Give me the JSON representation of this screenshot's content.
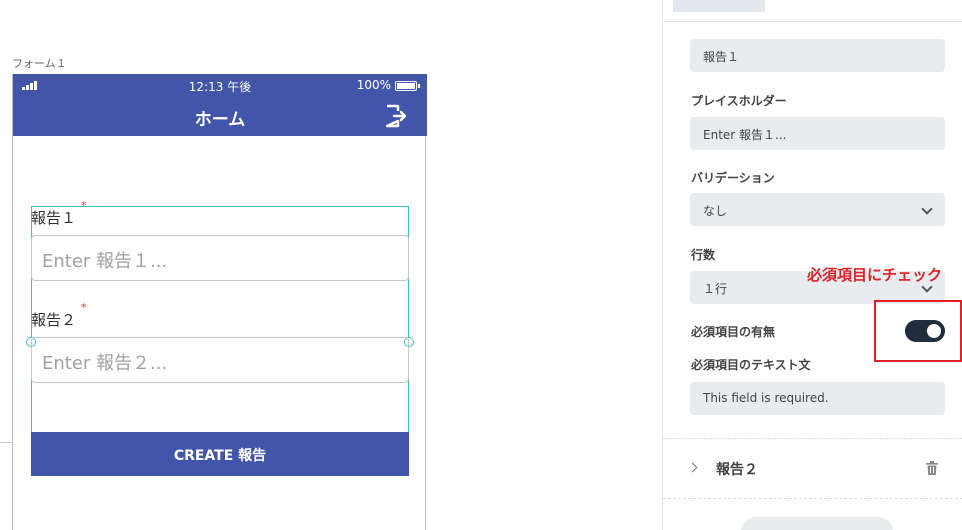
{
  "canvas": {
    "form_caption": "フォーム１"
  },
  "status_bar": {
    "time": "12:13 午後",
    "battery_text": "100%"
  },
  "nav": {
    "title": "ホーム",
    "logout_icon": "logout-icon"
  },
  "form": {
    "fields": [
      {
        "label": "報告１",
        "required_mark": "*",
        "placeholder": "Enter 報告１..."
      },
      {
        "label": "報告２",
        "required_mark": "*",
        "placeholder": "Enter 報告２..."
      }
    ],
    "submit_label": "CREATE 報告"
  },
  "panel": {
    "label_field_value": "報告１",
    "placeholder_label": "プレイスホルダー",
    "placeholder_value": "Enter 報告１...",
    "validation_label": "バリデーション",
    "validation_value": "なし",
    "rows_label": "行数",
    "rows_value": "１行",
    "required_label": "必須項目の有無",
    "required_on": true,
    "required_text_label": "必須項目のテキスト文",
    "required_text_value": "This field is required.",
    "accordion_item": "報告２"
  },
  "annotation": {
    "callout": "必須項目にチェック",
    "color": "#e01f26"
  },
  "colors": {
    "brand": "#4355a8",
    "selection": "#3bbfc6",
    "toggle": "#1f2d3d"
  }
}
